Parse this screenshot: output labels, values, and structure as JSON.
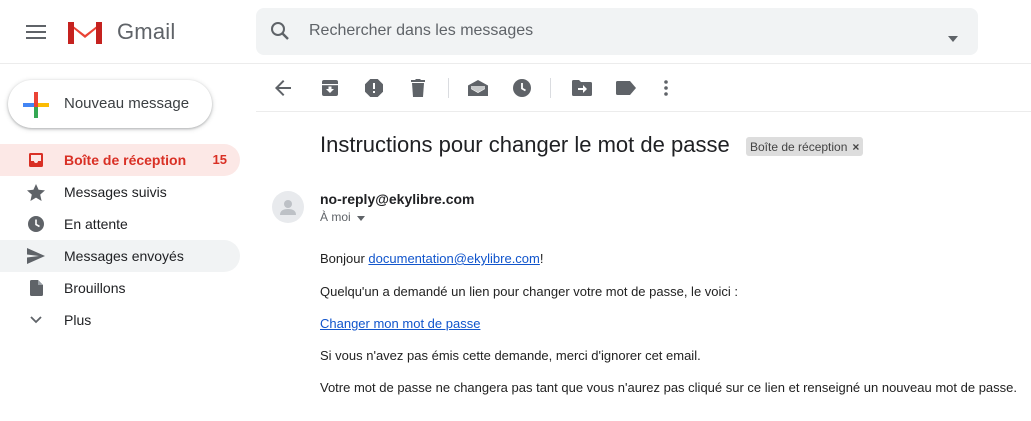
{
  "app": {
    "brand": "Gmail"
  },
  "search": {
    "placeholder": "Rechercher dans les messages"
  },
  "compose": {
    "label": "Nouveau message"
  },
  "sidebar": {
    "items": [
      {
        "label": "Boîte de réception",
        "count": "15",
        "icon": "inbox-icon"
      },
      {
        "label": "Messages suivis",
        "icon": "star-icon"
      },
      {
        "label": "En attente",
        "icon": "clock-icon"
      },
      {
        "label": "Messages envoyés",
        "icon": "send-icon"
      },
      {
        "label": "Brouillons",
        "icon": "draft-icon"
      },
      {
        "label": "Plus",
        "icon": "chevron-down-icon"
      }
    ]
  },
  "toolbar": {
    "icons": [
      "back-arrow-icon",
      "archive-icon",
      "report-spam-icon",
      "delete-icon",
      "mark-unread-icon",
      "snooze-icon",
      "move-to-icon",
      "label-icon",
      "more-vert-icon"
    ]
  },
  "message": {
    "subject": "Instructions pour changer le mot de passe",
    "label_chip": "Boîte de réception",
    "label_chip_close": "×",
    "sender": "no-reply@ekylibre.com",
    "recipient": "À moi",
    "greeting_prefix": "Bonjour ",
    "greeting_email": "documentation@ekylibre.com",
    "greeting_suffix": "!",
    "line1": "Quelqu'un a demandé un lien pour changer votre mot de passe, le voici :",
    "link_text": "Changer mon mot de passe",
    "line2": "Si vous n'avez pas émis cette demande, merci d'ignorer cet email.",
    "line3": "Votre mot de passe ne changera pas tant que vous n'aurez pas cliqué sur ce lien et renseigné un nouveau mot de passe."
  },
  "colors": {
    "accent_red": "#d93025",
    "active_bg": "#fce8e6",
    "link": "#1155cc",
    "search_bg": "#f1f3f4"
  }
}
